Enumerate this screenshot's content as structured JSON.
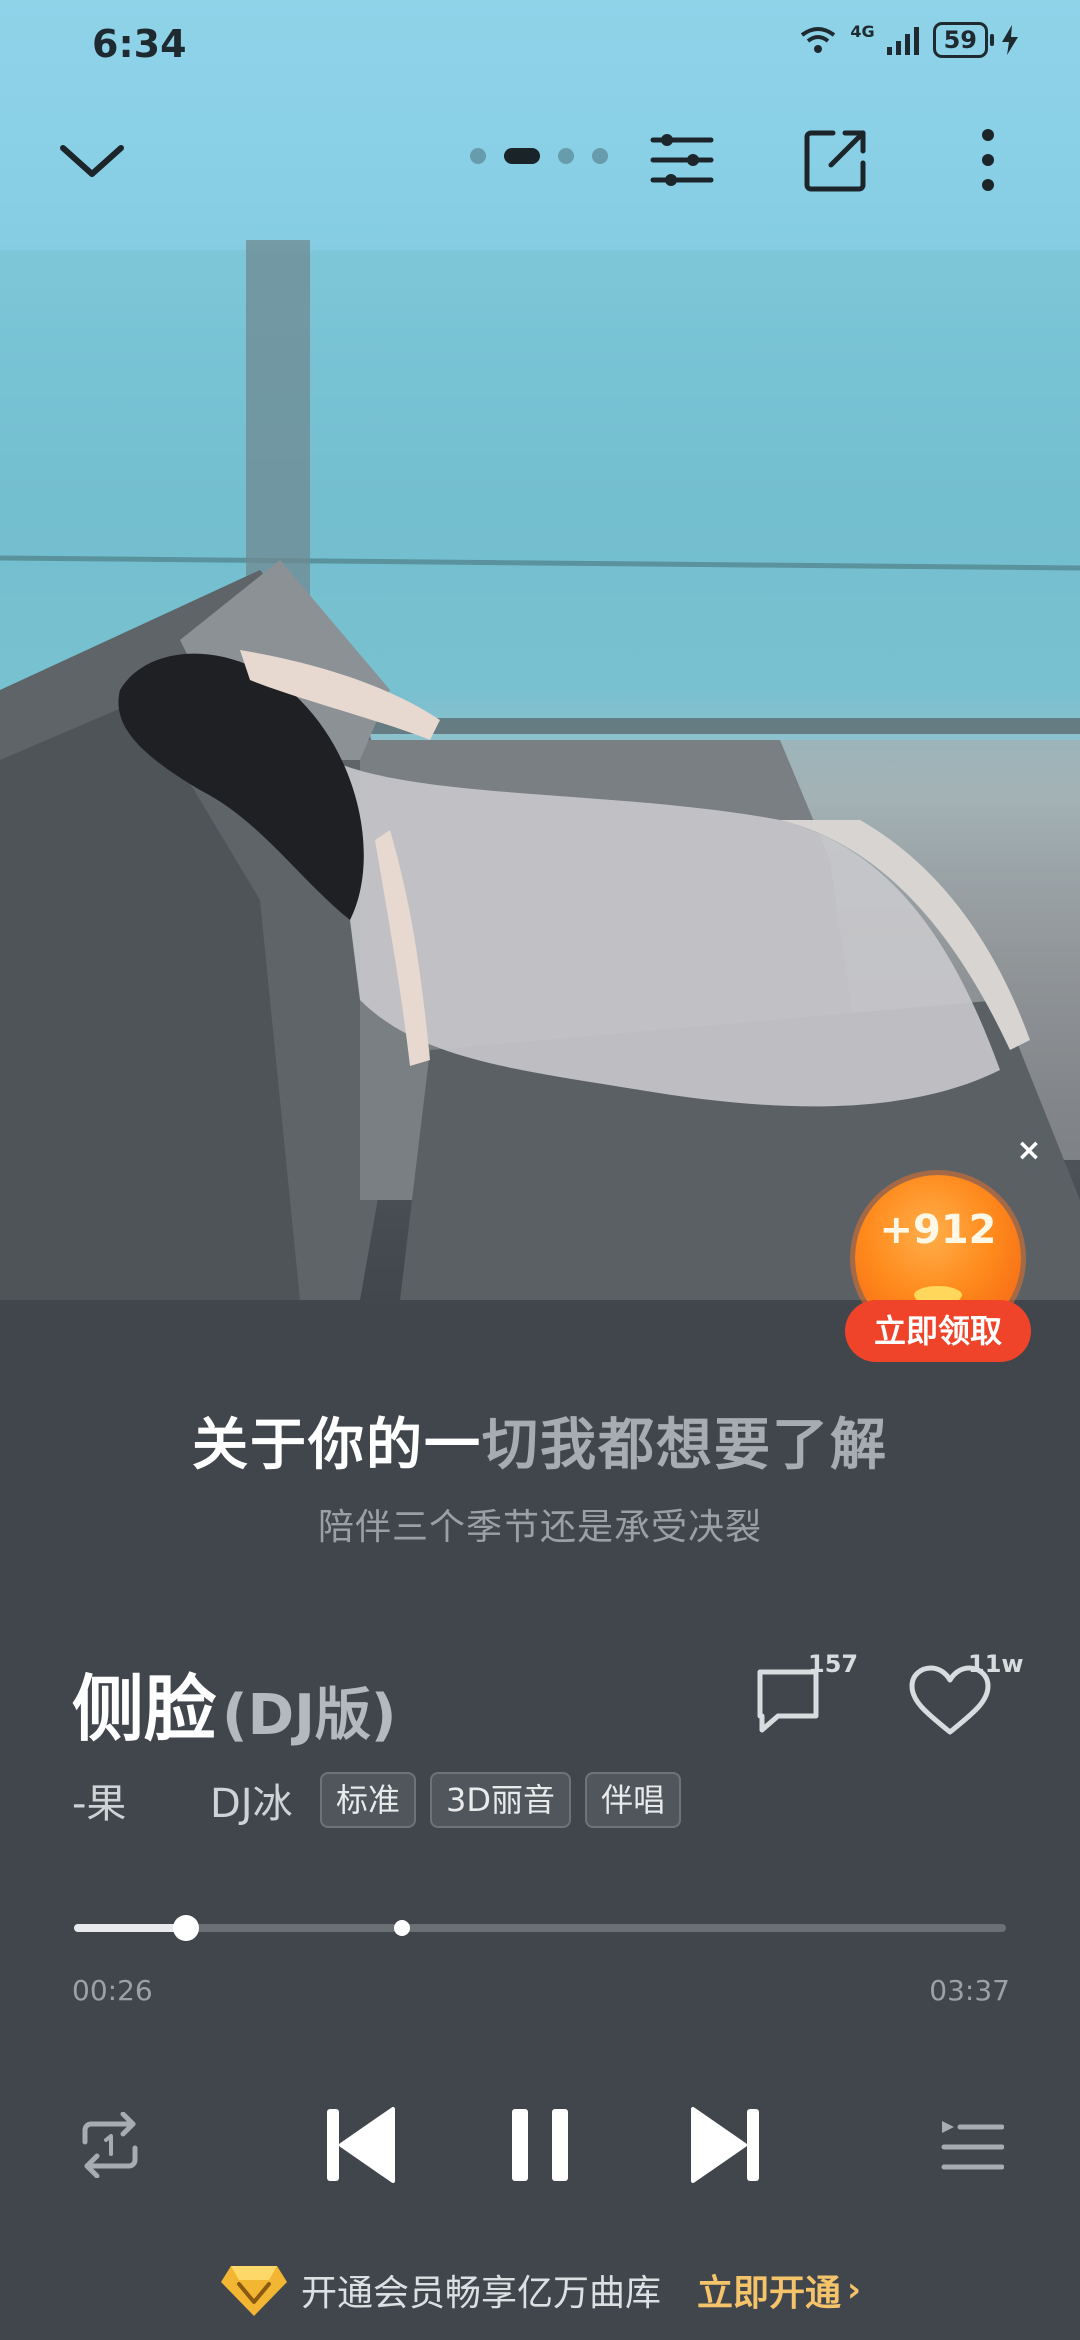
{
  "status_bar": {
    "time": "6:34",
    "network": "4G",
    "battery": "59"
  },
  "top_bar": {
    "page_count": 4,
    "active_page": 2
  },
  "coin_reward": {
    "value": "+912",
    "claim_label": "立即领取"
  },
  "lyrics": {
    "current_sung": "关于你的一",
    "current_unsung": "切我都想要了解",
    "next": "陪伴三个季节还是承受决裂"
  },
  "song": {
    "title": "侧脸",
    "version": "(DJ版)",
    "artist_1": "-果",
    "artist_2": "DJ冰",
    "tags": [
      "标准",
      "3D丽音",
      "伴唱"
    ],
    "comment_count": "157",
    "like_count": "11w"
  },
  "playback": {
    "elapsed": "00:26",
    "total": "03:37",
    "progress": 0.12,
    "climax_mark": 0.352
  },
  "vip_banner": {
    "text": "开通会员畅享亿万曲库",
    "cta": "立即开通"
  },
  "colors": {
    "accent_gold": "#f5c46a",
    "claim_red": "#f0442a",
    "coin_orange": "#ff8a1c"
  }
}
